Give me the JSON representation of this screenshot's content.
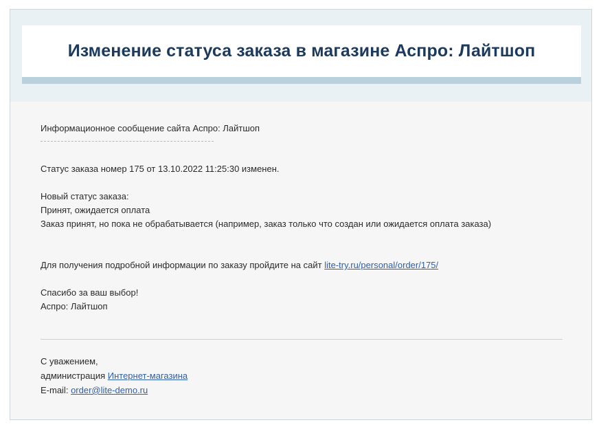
{
  "header": {
    "title": "Изменение статуса заказа в магазине Аспро: Лайтшоп"
  },
  "body": {
    "intro": "Информационное сообщение сайта Аспро: Лайтшоп",
    "status_line": "Статус заказа номер 175 от 13.10.2022 11:25:30 изменен.",
    "new_status_label": "Новый статус заказа:",
    "new_status_value": "Принят, ожидается оплата",
    "status_description": "Заказ принят, но пока не обрабатывается (например, заказ только что создан или ожидается оплата заказа)",
    "details_text": "Для получения подробной информации по заказу пройдите на сайт ",
    "details_link": "lite-try.ru/personal/order/175/",
    "thanks": "Спасибо за ваш выбор!",
    "shop_name": "Аспро: Лайтшоп"
  },
  "signature": {
    "regards": "С уважением,",
    "admin_prefix": "администрация ",
    "admin_link": "Интернет-магазина",
    "email_prefix": "E-mail: ",
    "email_link": "order@lite-demo.ru"
  },
  "colors": {
    "title": "#1b3a5c",
    "link": "#2f5fa8",
    "header_band": "#eaf1f4",
    "title_underline": "#b9d0dd",
    "body_bg": "#f6f6f6"
  }
}
